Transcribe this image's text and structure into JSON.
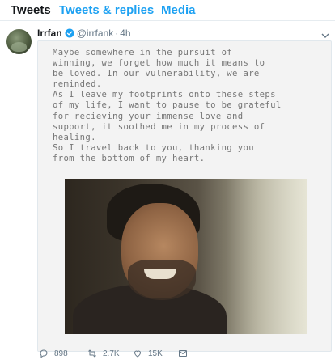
{
  "tabs": [
    "Tweets",
    "Tweets & replies",
    "Media"
  ],
  "tweet": {
    "author": "Irrfan",
    "handle": "@irrfank",
    "separator": "·",
    "time": "4h",
    "note_text": "Maybe somewhere in the pursuit of\nwinning, we forget how much it means to\nbe loved. In our vulnerability, we are\nreminded.\nAs I leave my footprints onto these steps\nof my life, I want to pause to be grateful\nfor recieving your immense love and\nsupport, it soothed me in my process of\nhealing.\nSo I travel  back to you, thanking you\nfrom the bottom of my heart.",
    "replies": "898",
    "retweets": "2.7K",
    "likes": "15K"
  },
  "colors": {
    "accent": "#1da1f2",
    "text": "#14171a",
    "secondary": "#657786"
  },
  "icons": [
    "verified-badge-icon",
    "chevron-down-icon",
    "reply-icon",
    "retweet-icon",
    "like-icon",
    "message-icon"
  ]
}
